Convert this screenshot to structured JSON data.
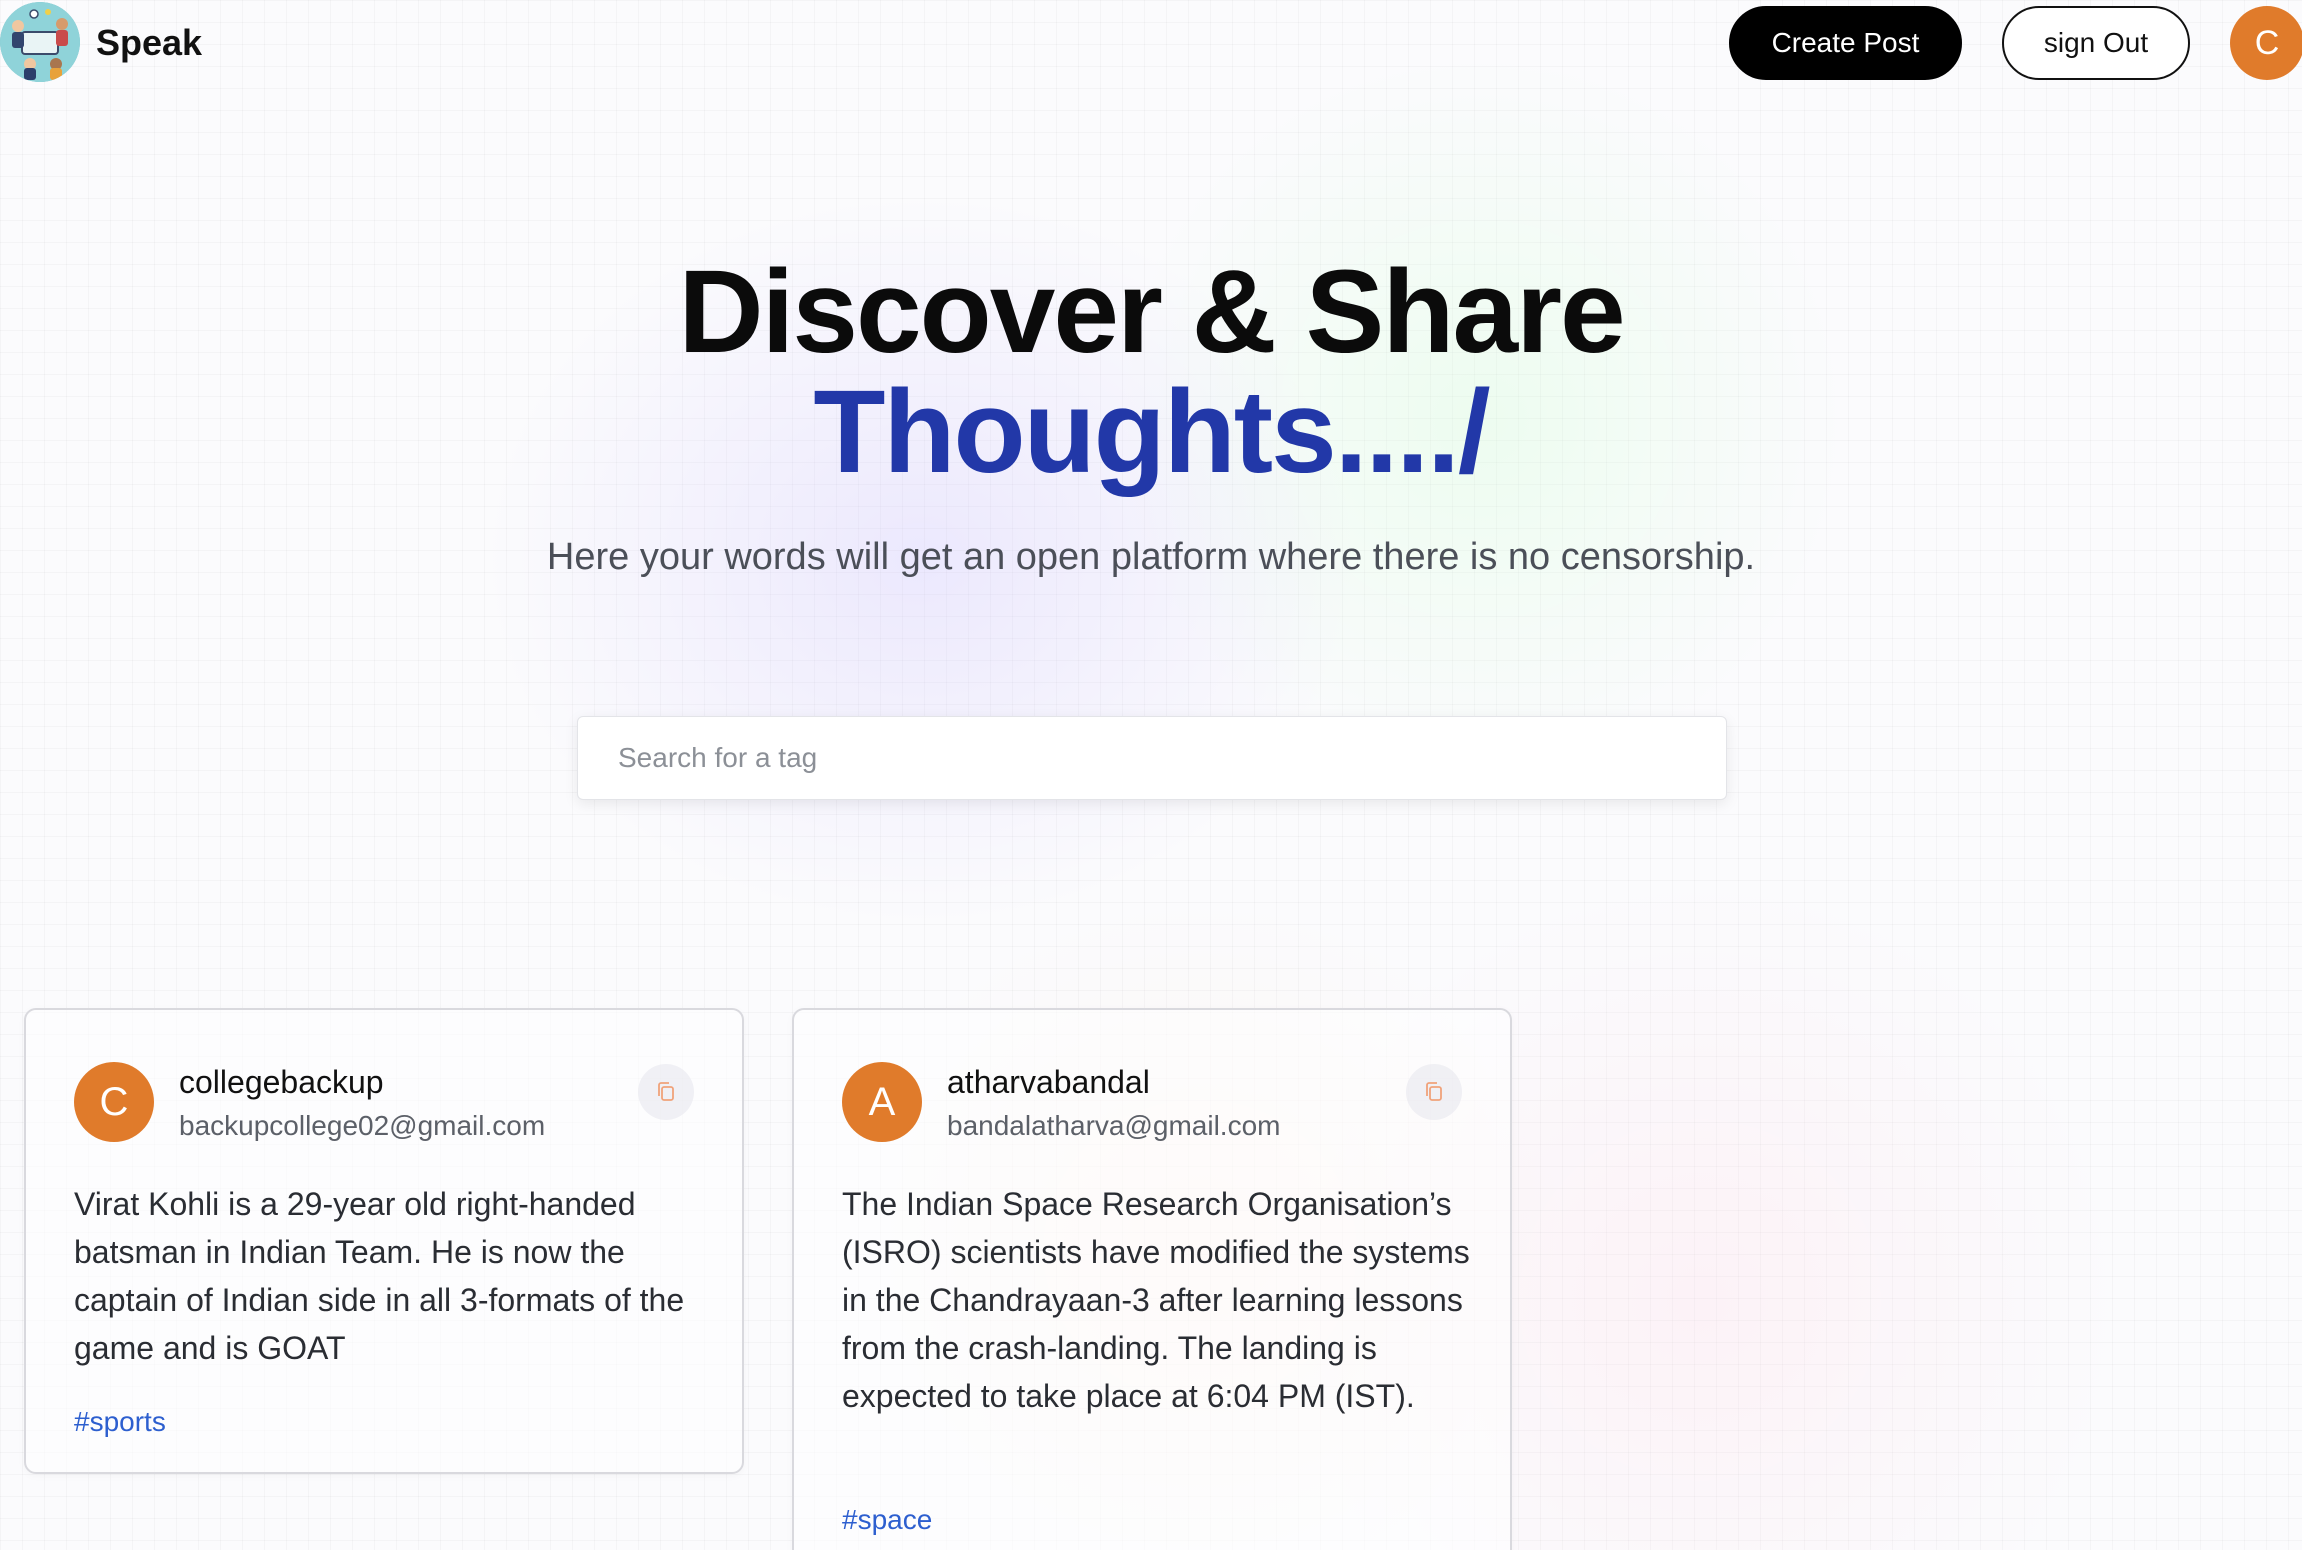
{
  "nav": {
    "brand": "Speak",
    "create_post_label": "Create Post",
    "sign_out_label": "sign Out",
    "avatar_initial": "C"
  },
  "hero": {
    "title_line1": "Discover & Share",
    "title_line2": "Thoughts..../",
    "subtitle": "Here your words will get an open platform where there is no censorship."
  },
  "search": {
    "placeholder": "Search for a tag",
    "value": ""
  },
  "posts": [
    {
      "avatar_initial": "C",
      "username": "collegebackup",
      "email": "backupcollege02@gmail.com",
      "body": "Virat Kohli is a 29-year old right-handed batsman in Indian Team. He is now the captain of Indian side in all 3-formats of the game and is GOAT",
      "tag": "#sports",
      "copy_icon": "copy-icon"
    },
    {
      "avatar_initial": "A",
      "username": "atharvabandal",
      "email": "bandalatharva@gmail.com",
      "body": "The Indian Space Research Organisation’s (ISRO) scientists have modified the systems in the Chandrayaan-3 after learning lessons from the crash-landing. The landing is expected to take place at 6:04 PM (IST).",
      "tag": "#space",
      "copy_icon": "copy-icon"
    }
  ],
  "colors": {
    "accent_blue": "#2238a8",
    "avatar_orange": "#e07b2b",
    "tag_blue": "#2d5fcf",
    "button_black": "#000000"
  }
}
